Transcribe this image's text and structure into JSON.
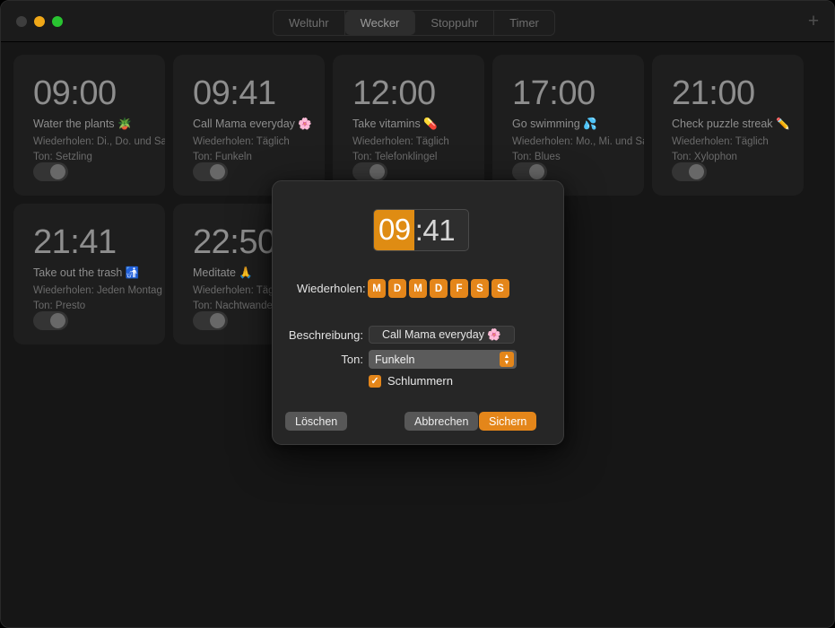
{
  "window": {
    "traffic_lights": [
      "close",
      "minimize",
      "maximize"
    ],
    "add_button_icon": "plus-icon",
    "accent_color": "#e4861a",
    "background_color": "#161616",
    "card_color": "#1e1e1e"
  },
  "tabs": [
    {
      "label": "Weltuhr",
      "active": false
    },
    {
      "label": "Wecker",
      "active": true
    },
    {
      "label": "Stoppuhr",
      "active": false
    },
    {
      "label": "Timer",
      "active": false
    }
  ],
  "alarms": [
    {
      "time": "09:00",
      "description": "Water the plants 🪴",
      "repeat": "Wiederholen: Di., Do. und Sa.",
      "sound": "Ton: Setzling",
      "enabled": true
    },
    {
      "time": "09:41",
      "description": "Call Mama everyday 🌸",
      "repeat": "Wiederholen: Täglich",
      "sound": "Ton: Funkeln",
      "enabled": true
    },
    {
      "time": "12:00",
      "description": "Take vitamins 💊",
      "repeat": "Wiederholen: Täglich",
      "sound": "Ton: Telefonklingel",
      "enabled": true
    },
    {
      "time": "17:00",
      "description": "Go swimming 💦",
      "repeat": "Wiederholen: Mo., Mi. und Sa.",
      "sound": "Ton: Blues",
      "enabled": true
    },
    {
      "time": "21:00",
      "description": "Check puzzle streak ✏️",
      "repeat": "Wiederholen: Täglich",
      "sound": "Ton: Xylophon",
      "enabled": true
    },
    {
      "time": "21:41",
      "description": "Take out the trash 🚮",
      "repeat": "Wiederholen: Jeden Montag",
      "sound": "Ton: Presto",
      "enabled": true
    },
    {
      "time": "22:50",
      "description": "Meditate 🙏",
      "repeat": "Wiederholen: Täglich",
      "sound": "Ton: Nachtwanderung",
      "enabled": true
    }
  ],
  "dialog": {
    "time": {
      "hours": "09",
      "rest": ":41",
      "selected_segment": "hours"
    },
    "repeat_label": "Wiederholen:",
    "weekdays": [
      {
        "letter": "M",
        "selected": true
      },
      {
        "letter": "D",
        "selected": true
      },
      {
        "letter": "M",
        "selected": true
      },
      {
        "letter": "D",
        "selected": true
      },
      {
        "letter": "F",
        "selected": true
      },
      {
        "letter": "S",
        "selected": true
      },
      {
        "letter": "S",
        "selected": true
      }
    ],
    "description_label": "Beschreibung:",
    "description_value": "Call Mama everyday 🌸",
    "sound_label": "Ton:",
    "sound_value": "Funkeln",
    "snooze_label": "Schlummern",
    "snooze_checked": true,
    "snooze_check_glyph": "✓",
    "buttons": {
      "delete": "Löschen",
      "cancel": "Abbrechen",
      "save": "Sichern"
    }
  }
}
